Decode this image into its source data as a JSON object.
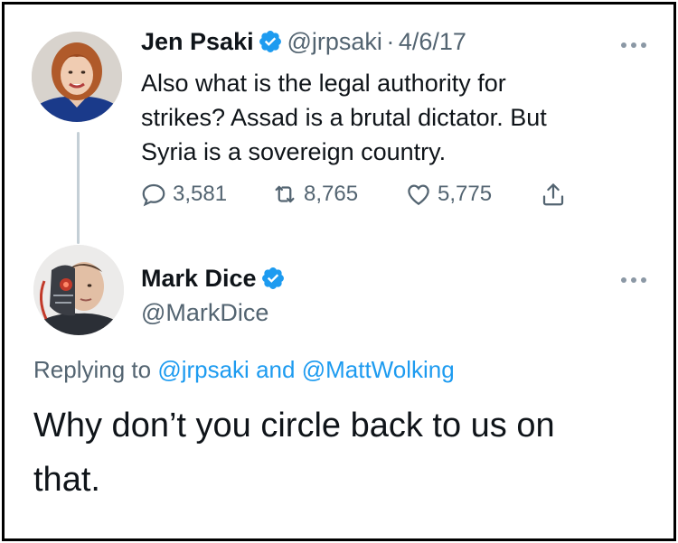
{
  "tweet1": {
    "name": "Jen Psaki",
    "handle": "@jrpsaki",
    "separator": "·",
    "date": "4/6/17",
    "text_lines": [
      "Also what is the legal authority for",
      "strikes? Assad is a brutal dictator. But",
      "Syria is a sovereign country."
    ],
    "replies": "3,581",
    "retweets": "8,765",
    "likes": "5,775",
    "verified": true
  },
  "tweet2": {
    "name": "Mark Dice",
    "handle": "@MarkDice",
    "verified": true,
    "replying_prefix": "Replying to",
    "replying_mention_1": "@jrpsaki",
    "replying_and": "and",
    "replying_mention_2": "@MattWolking",
    "text_lines": [
      "Why don’t you circle back to us on",
      "that."
    ]
  },
  "colors": {
    "verified_blue": "#1d9bf0",
    "link_blue": "#1d9bf0",
    "secondary_text": "#536471",
    "thread_line": "#c4cfd6"
  },
  "icons": {
    "verified": "verified-badge-icon",
    "reply": "reply-icon",
    "retweet": "retweet-icon",
    "like": "heart-icon",
    "share": "share-icon",
    "more": "more-dots-icon"
  }
}
